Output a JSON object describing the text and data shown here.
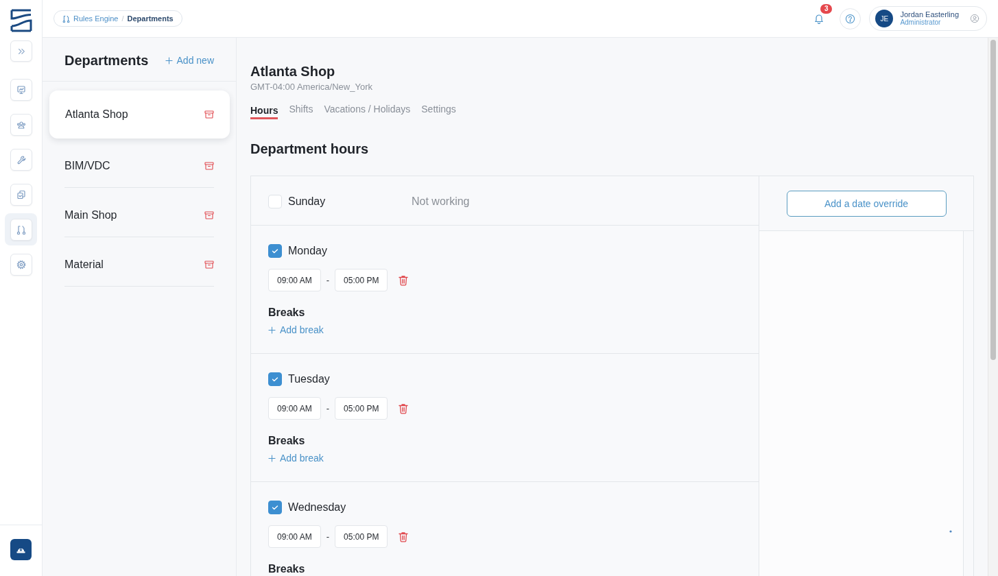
{
  "rail": {
    "nav": [
      {
        "kind": "board",
        "selected": false
      },
      {
        "kind": "team",
        "selected": false
      },
      {
        "kind": "wrench",
        "selected": false
      },
      {
        "kind": "copy",
        "selected": false
      },
      {
        "kind": "flow",
        "selected": true
      },
      {
        "kind": "gear",
        "selected": false
      }
    ]
  },
  "breadcrumb": {
    "items": [
      {
        "label": "Rules Engine",
        "current": false
      },
      {
        "label": "Departments",
        "current": true
      }
    ],
    "separator": "/"
  },
  "topbar": {
    "notification_count": "3",
    "user": {
      "initials": "JE",
      "name": "Jordan Easterling",
      "role": "Administrator"
    }
  },
  "departments": {
    "title": "Departments",
    "add_label": "Add new",
    "items": [
      {
        "name": "Atlanta Shop",
        "selected": true
      },
      {
        "name": "BIM/VDC",
        "selected": false
      },
      {
        "name": "Main Shop",
        "selected": false
      },
      {
        "name": "Material",
        "selected": false
      }
    ]
  },
  "detail": {
    "title": "Atlanta Shop",
    "timezone": "GMT-04:00 America/New_York",
    "tabs": [
      {
        "label": "Hours",
        "selected": true
      },
      {
        "label": "Shifts",
        "selected": false
      },
      {
        "label": "Vacations / Holidays",
        "selected": false
      },
      {
        "label": "Settings",
        "selected": false
      }
    ],
    "section_title": "Department hours",
    "days": [
      {
        "name": "Sunday",
        "checked": false,
        "status": "Not working"
      },
      {
        "name": "Monday",
        "checked": true,
        "start": "09:00 AM",
        "separator": "-",
        "end": "05:00 PM",
        "breaks_label": "Breaks",
        "add_break": "Add break"
      },
      {
        "name": "Tuesday",
        "checked": true,
        "start": "09:00 AM",
        "separator": "-",
        "end": "05:00 PM",
        "breaks_label": "Breaks",
        "add_break": "Add break"
      },
      {
        "name": "Wednesday",
        "checked": true,
        "start": "09:00 AM",
        "separator": "-",
        "end": "05:00 PM",
        "breaks_label": "Breaks"
      }
    ],
    "override_button": "Add a date override"
  }
}
